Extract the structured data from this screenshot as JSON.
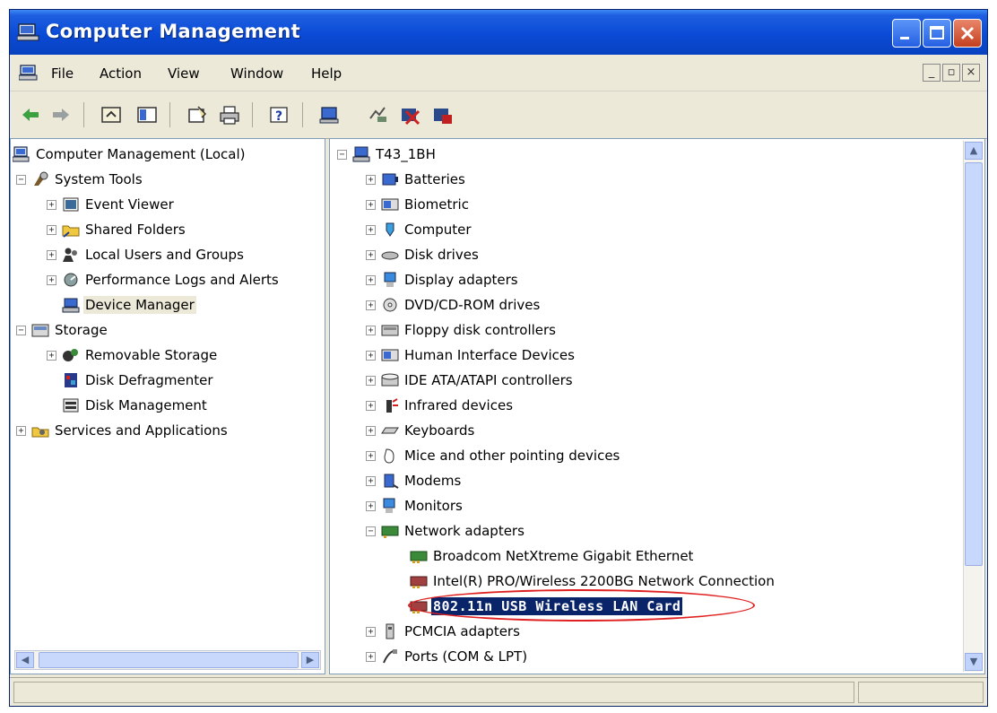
{
  "window": {
    "title": "Computer Management"
  },
  "menu": {
    "items": [
      "File",
      "Action",
      "View",
      "Window",
      "Help"
    ]
  },
  "toolbar": {
    "icons": [
      "back-icon",
      "forward-icon",
      "up-icon",
      "show-hide-tree-icon",
      "properties-icon",
      "print-icon",
      "help-icon",
      "scan-hardware-icon",
      "update-driver-icon",
      "uninstall-icon",
      "disable-icon"
    ]
  },
  "left_tree": {
    "root": "Computer Management (Local)",
    "system_tools": "System Tools",
    "event_viewer": "Event Viewer",
    "shared_folders": "Shared Folders",
    "local_users": "Local Users and Groups",
    "perf_logs": "Performance Logs and Alerts",
    "device_manager": "Device Manager",
    "storage": "Storage",
    "removable_storage": "Removable Storage",
    "disk_defrag": "Disk Defragmenter",
    "disk_mgmt": "Disk Management",
    "services": "Services and Applications"
  },
  "right_tree": {
    "root": "T43_1BH",
    "categories": [
      "Batteries",
      "Biometric",
      "Computer",
      "Disk drives",
      "Display adapters",
      "DVD/CD-ROM drives",
      "Floppy disk controllers",
      "Human Interface Devices",
      "IDE ATA/ATAPI controllers",
      "Infrared devices",
      "Keyboards",
      "Mice and other pointing devices",
      "Modems",
      "Monitors",
      "Network adapters"
    ],
    "network_adapters": [
      "Broadcom NetXtreme Gigabit Ethernet",
      "Intel(R) PRO/Wireless 2200BG Network Connection",
      "802.11n USB Wireless LAN Card"
    ],
    "after": [
      "PCMCIA adapters",
      "Ports (COM & LPT)"
    ]
  },
  "colors": {
    "title_bar": "#0a4ad6",
    "selection": "#0a246a",
    "highlight_circle": "#e02020"
  }
}
